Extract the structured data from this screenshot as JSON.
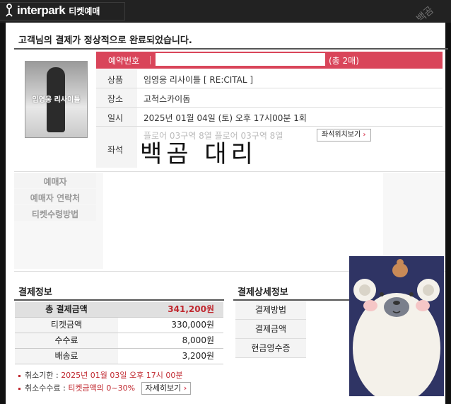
{
  "header": {
    "brand": "interpark",
    "sub": "티켓예매"
  },
  "heading": "고객님의 결제가 정상적으로 완료되었습니다.",
  "poster": {
    "title": "임영웅 리사이틀"
  },
  "reservation": {
    "label": "예약번호",
    "count": "(총 2매)"
  },
  "details": [
    {
      "key": "상품",
      "value": "임영웅 리사이틀  [ RE:CITAL ]"
    },
    {
      "key": "장소",
      "value": "고척스카이돔"
    },
    {
      "key": "일시",
      "value": "2025년 01월 04일 (토) 오후 17시00분 1회"
    }
  ],
  "seat": {
    "key": "좌석",
    "faded": "플로어 03구역 8열     플로어 03구역 8열",
    "button": "좌석위치보기"
  },
  "overlay_text": "백곰 대리",
  "buyer": {
    "items": [
      "예매자",
      "예매자 연락처",
      "티켓수령방법"
    ]
  },
  "payment": {
    "title": "결제정보",
    "rows": [
      {
        "label": "총 결제금액",
        "value": "341,200원"
      },
      {
        "label": "티켓금액",
        "value": "330,000원"
      },
      {
        "label": "수수료",
        "value": "8,000원"
      },
      {
        "label": "배송료",
        "value": "3,200원"
      }
    ]
  },
  "payment_detail": {
    "title": "결제상세정보",
    "rows": [
      "결제방법",
      "결제금액",
      "현금영수증"
    ]
  },
  "notes": {
    "cancel_label": "취소기한 : ",
    "cancel_value": "2025년 01월 03일 오후 17시 00분",
    "fee_label": "취소수수료 : ",
    "fee_value": "티켓금액의 0~30%",
    "fee_button": "자세히보기"
  },
  "colors": {
    "accent": "#d9455a",
    "price_red": "#c0282f",
    "sticker_bg": "#2f3464"
  },
  "icons": {
    "logo": "interpark-logo-icon",
    "arrow": "chevron-right-icon"
  }
}
